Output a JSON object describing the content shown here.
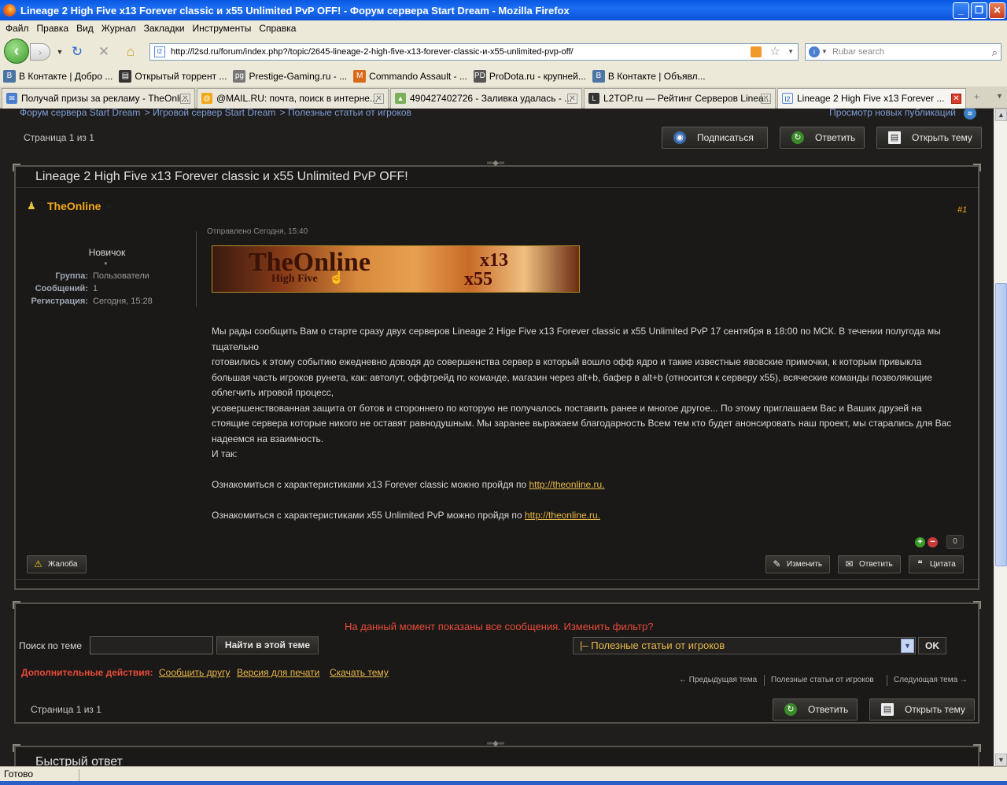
{
  "window": {
    "title": "Lineage 2 High Five x13 Forever classic и x55 Unlimited PvP OFF! - Форум сервера Start Dream - Mozilla Firefox"
  },
  "menu": [
    "Файл",
    "Правка",
    "Вид",
    "Журнал",
    "Закладки",
    "Инструменты",
    "Справка"
  ],
  "nav": {
    "url": "http://l2sd.ru/forum/index.php?/topic/2645-lineage-2-high-five-x13-forever-classic-и-x55-unlimited-pvp-off/",
    "search_placeholder": "Rubar search"
  },
  "bookmarks": [
    "В Контакте | Добро ...",
    "Открытый торрент ...",
    "Prestige-Gaming.ru - ...",
    "Commando Assault - ...",
    "ProDota.ru - крупней...",
    "В Контакте | Объявл..."
  ],
  "tabs": [
    "Получай призы за рекламу - TheOnli...",
    "@MAIL.RU: почта, поиск в интерне...",
    "490427402726 - Заливка удалась - ...",
    "L2TOP.ru — Рейтинг Серверов Linea...",
    "Lineage 2 High Five x13 Forever ..."
  ],
  "crumbs": [
    "Форум сервера Start Dream",
    ">  Игровой сервер Start Dream",
    ">  Полезные статьи от игроков"
  ],
  "new_pubs": "Просмотр новых публикаций",
  "page_info": "Страница 1 из 1",
  "top_buttons": {
    "subscribe": "Подписаться",
    "reply": "Ответить",
    "open": "Открыть тему"
  },
  "topic_title": "Lineage 2 High Five x13 Forever classic и x55 Unlimited PvP OFF!",
  "post": {
    "author": "TheOnline",
    "number": "#1",
    "rank": "Новичок",
    "group_k": "Группа:",
    "group_v": "Пользователи",
    "posts_k": "Сообщений:",
    "posts_v": "1",
    "reg_k": "Регистрация:",
    "reg_v": "Сегодня, 15:28",
    "posted": "Отправлено Сегодня, 15:40",
    "banner": {
      "name": "TheOnline",
      "sub": "High Five",
      "r1": "x13",
      "r2": "x55"
    },
    "lines": [
      "Мы рады сообщить Вам о старте сразу двух серверов Lineage 2 Hige Five x13 Forever classic и x55 Unlimited PvP 17 сентября в 18:00 по МСК. В течении полугода мы тщательно",
      "готовились к этому событию ежедневно доводя до совершенства сервер в который вошло офф ядро и такие известные явовские примочки, к которым привыкла большая часть игроков рунета, как: автолут, оффтрейд по команде, магазин через alt+b, бафер в alt+b (относится к серверу x55), всяческие команды позволяющие облегчить игровой процесс,",
      "усовершенствованная защита от ботов и стороннего по которую не получалось поставить ранее и многое другое... По этому приглашаем Вас и Ваших друзей на стоящие сервера которые никого не оставят равнодушным. Мы заранее выражаем благодарность Всем тем кто будет анонсировать наш проект, мы старались для Вас надеемся на взаимность.",
      "И так:"
    ],
    "link1_text": "Ознакомиться с характеристиками x13 Forever classic можно пройдя по ",
    "link1": "http://theonline.ru.",
    "link2_text": "Ознакомиться с характеристиками x55 Unlimited PvP можно пройдя по ",
    "link2": "http://theonline.ru.",
    "rep_count": "0",
    "complaint": "Жалоба",
    "edit": "Изменить",
    "reply": "Ответить",
    "quote": "Цитата"
  },
  "bottom": {
    "filter": "На данный момент показаны все сообщения. Изменить фильтр?",
    "search_label": "Поиск по теме",
    "search_btn": "Найти в этой теме",
    "jump_value": "|– Полезные статьи от игроков",
    "ok": "OK",
    "extra_label": "Дополнительные действия:",
    "extra_links": [
      "Сообщить другу",
      "Версия для печати",
      "Скачать тему"
    ],
    "prev": "← Предыдущая тема",
    "forum": "Полезные статьи от игроков",
    "next": "Следующая тема →",
    "page_info": "Страница 1 из 1",
    "reply": "Ответить",
    "open": "Открыть тему"
  },
  "quick_reply": "Быстрый ответ",
  "status": "Готово"
}
